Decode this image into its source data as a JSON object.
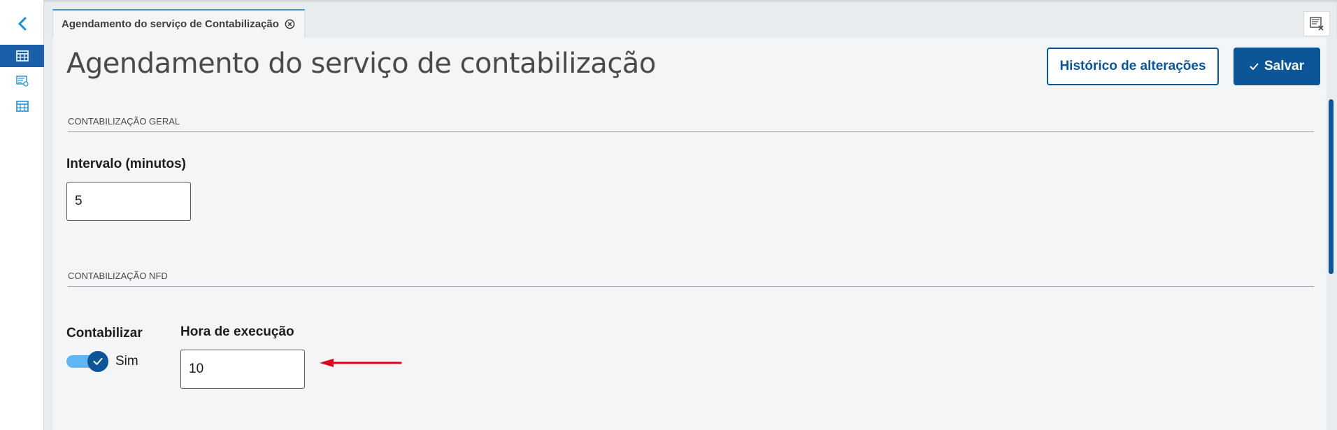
{
  "tab": {
    "label": "Agendamento do serviço de Contabilização"
  },
  "page": {
    "title": "Agendamento do serviço de contabilização"
  },
  "actions": {
    "history_label": "Histórico de alterações",
    "save_label": "Salvar"
  },
  "sections": {
    "general": {
      "title": "CONTABILIZAÇÃO GERAL",
      "interval_label": "Intervalo (minutos)",
      "interval_value": "5"
    },
    "nfd": {
      "title": "CONTABILIZAÇÃO NFD",
      "contabilizar_label": "Contabilizar",
      "contabilizar_state": "Sim",
      "hora_label": "Hora de execução",
      "hora_value": "10"
    }
  },
  "icons": {
    "back": "chevron-left-icon",
    "nav1": "table-icon",
    "nav2": "monitor-list-icon",
    "nav3": "grid-icon",
    "close_tab": "close-circle-icon",
    "top_action": "close-all-tabs-icon",
    "check": "check-icon"
  },
  "colors": {
    "primary": "#0c5697",
    "accent": "#3c8fd6",
    "switch_track": "#5fb6f2",
    "arrow": "#e0001b"
  }
}
